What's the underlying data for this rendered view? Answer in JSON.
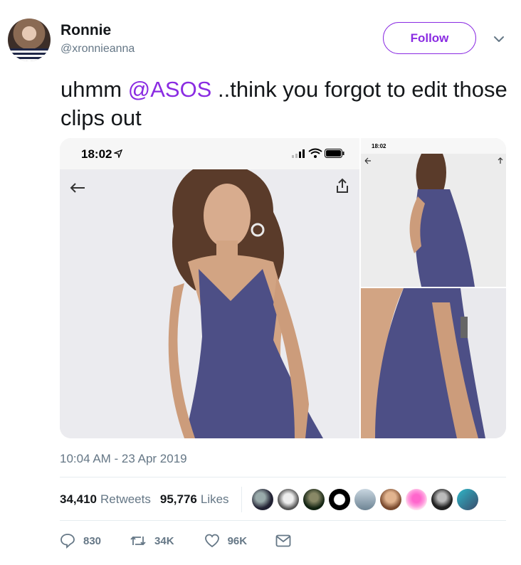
{
  "author": {
    "name": "Ronnie",
    "handle": "@xronnieanna"
  },
  "follow_button": {
    "label": "Follow"
  },
  "tweet": {
    "text_before": "uhmm ",
    "mention": "@ASOS",
    "text_after": " ..think you forgot to edit those clips out",
    "timestamp": "10:04 AM - 23 Apr 2019"
  },
  "media": {
    "main_status_time": "18:02",
    "side_status_time": "18:02"
  },
  "stats": {
    "retweets_count": "34,410",
    "retweets_label": "Retweets",
    "likes_count": "95,776",
    "likes_label": "Likes"
  },
  "actions": {
    "reply_count": "830",
    "retweet_count": "34K",
    "like_count": "96K"
  },
  "colors": {
    "accent": "#8a2be2",
    "muted": "#657786",
    "dress": "#4d4f86"
  },
  "liker_avatar_icons": [
    "liker-avatar-1",
    "liker-avatar-2",
    "liker-avatar-3",
    "liker-avatar-4",
    "liker-avatar-5",
    "liker-avatar-6",
    "liker-avatar-7",
    "liker-avatar-8",
    "liker-avatar-9"
  ]
}
